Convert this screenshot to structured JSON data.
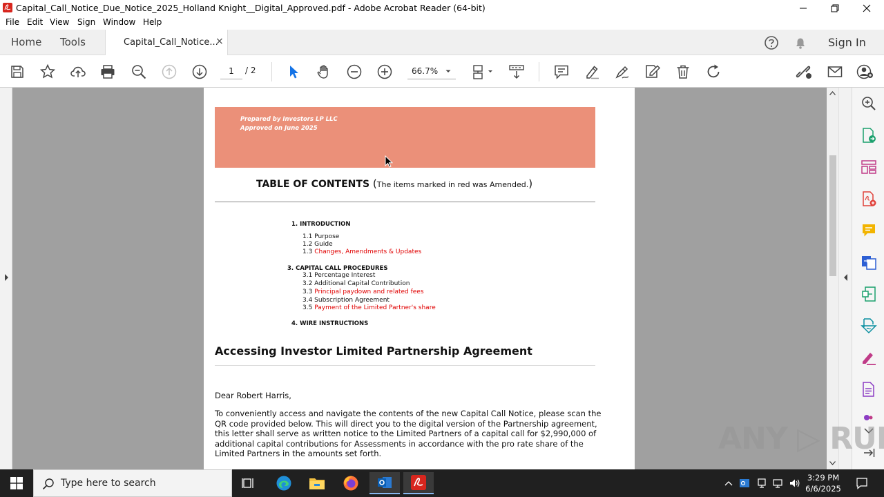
{
  "window": {
    "title": "Capital_Call_Notice_Due_Notice_2025_Holland  Knight__Digital_Approved.pdf - Adobe Acrobat Reader (64-bit)"
  },
  "menu": [
    "File",
    "Edit",
    "View",
    "Sign",
    "Window",
    "Help"
  ],
  "tabs": {
    "home": "Home",
    "tools": "Tools",
    "document": "Capital_Call_Notice...",
    "close": "×",
    "sign_in": "Sign In"
  },
  "toolbar": {
    "page_current": "1",
    "page_total": "/  2",
    "zoom": "66.7%"
  },
  "document": {
    "banner_line1": "Prepared by Investors LP LLC",
    "banner_line2": "Approved on June 2025",
    "toc_title": "TABLE OF CONTENTS",
    "toc_open": "(",
    "toc_note": "The items marked in red was Amended.",
    "toc_close": ")",
    "toc": [
      {
        "text": "1. INTRODUCTION",
        "type": "heading",
        "color": "#111111"
      },
      {
        "text": "1.1 Purpose",
        "type": "item",
        "color": "#111111"
      },
      {
        "text": "1.2 Guide",
        "type": "item",
        "color": "#111111"
      },
      {
        "text": "1.3",
        "type": "item",
        "color": "#111111",
        "red": "Changes, Amendments & Updates"
      },
      {
        "text": "3. CAPITAL CALL PROCEDURES",
        "type": "heading",
        "color": "#111111"
      },
      {
        "text": "3.1 Percentage Interest",
        "type": "item",
        "color": "#111111"
      },
      {
        "text": "3.2 Additional Capital Contribution",
        "type": "item",
        "color": "#111111"
      },
      {
        "text": "3.3",
        "type": "item",
        "color": "#111111",
        "red": "Principal paydown and related fees"
      },
      {
        "text": "3.4 Subscription Agreement",
        "type": "item",
        "color": "#111111"
      },
      {
        "text": "3.5",
        "type": "item",
        "color": "#111111",
        "red": "Payment of the Limited Partner's share"
      },
      {
        "text": "4. WIRE INSTRUCTIONS",
        "type": "heading",
        "color": "#111111"
      }
    ],
    "heading": "Accessing Investor Limited Partnership Agreement",
    "greeting": "Dear Robert Harris,",
    "paragraph_lines": [
      "To conveniently access and navigate the contents of the new Capital Call Notice, please scan the",
      "QR code provided below. This will direct you to the digital version of the Partnership agreement,",
      "this letter shall serve as written notice to the Limited Partners of a capital call for $2,990,000 of",
      "additional capital contributions for Assessments in accordance with the pro rate share of the",
      "Limited Partners in the amounts set forth."
    ]
  },
  "watermark": "ANY ▷ RUN",
  "taskbar": {
    "search_placeholder": "Type here to search",
    "time": "3:29 PM",
    "date": "6/6/2025"
  },
  "colors": {
    "banner": "#eb9079",
    "amended_red": "#e00000",
    "acrobat_red": "#d7261e",
    "select_blue": "#1473e6"
  }
}
